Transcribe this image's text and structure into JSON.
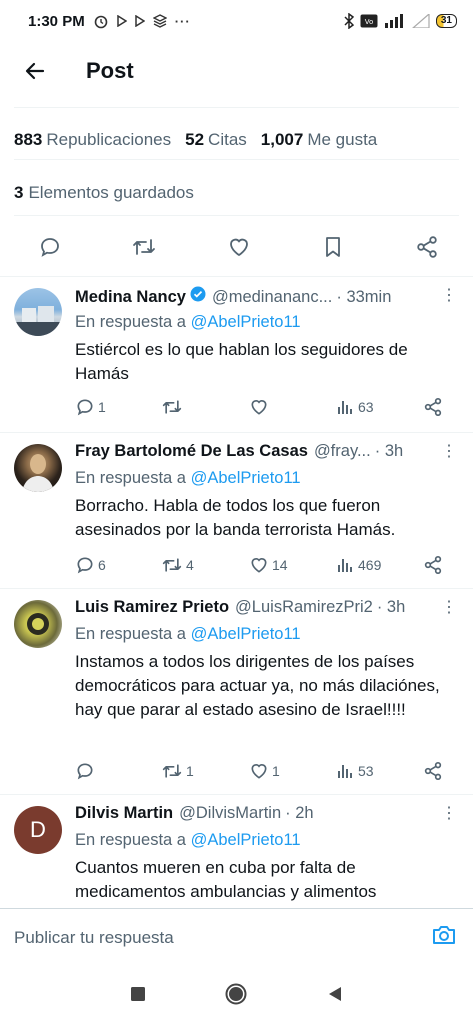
{
  "status_bar": {
    "time": "1:30 PM",
    "notif_icons": [
      "alarm-icon",
      "play-icon",
      "play-icon",
      "stack-icon",
      "more-dots-icon"
    ],
    "battery": "31"
  },
  "header": {
    "title": "Post"
  },
  "stats": {
    "reposts_count": "883",
    "reposts_label": "Republicaciones",
    "quotes_count": "52",
    "quotes_label": "Citas",
    "likes_count": "1,007",
    "likes_label": "Me gusta"
  },
  "saved": {
    "count": "3",
    "label": "Elementos guardados"
  },
  "replies": [
    {
      "name": "Medina Nancy",
      "verified": true,
      "handle": "@medinananc...",
      "time": "· 33min",
      "in_reply_prefix": "En respuesta a",
      "in_reply_mention": "@AbelPrieto11",
      "text": "Estiércol es lo que hablan los seguidores de Hamás",
      "replies": "1",
      "reposts": "",
      "likes": "",
      "views": "63"
    },
    {
      "name": "Fray Bartolomé De Las Casas",
      "handle": "@fray...",
      "time": "· 3h",
      "in_reply_prefix": "En respuesta a",
      "in_reply_mention": "@AbelPrieto11",
      "text": "Borracho. Habla de todos los que fueron asesinados por la banda terrorista Hamás.",
      "replies": "6",
      "reposts": "4",
      "likes": "14",
      "views": "469"
    },
    {
      "name": "Luis Ramirez Prieto",
      "handle": "@LuisRamirezPri2",
      "time": "· 3h",
      "in_reply_prefix": "En respuesta a",
      "in_reply_mention": "@AbelPrieto11",
      "text": "Instamos a todos los dirigentes de los países democráticos para actuar ya, no más dilaciónes, hay que parar al estado asesino de Israel!!!!",
      "replies": "",
      "reposts": "1",
      "likes": "1",
      "views": "53"
    },
    {
      "name": "Dilvis Martin",
      "handle": "@DilvisMartin",
      "time": "· 2h",
      "avatar_letter": "D",
      "in_reply_prefix": "En respuesta a",
      "in_reply_mention": "@AbelPrieto11",
      "text": "Cuantos mueren en cuba por falta de medicamentos ambulancias y alimentos"
    }
  ],
  "composer": {
    "placeholder": "Publicar tu respuesta"
  },
  "colors": {
    "accent": "#1d9bf0",
    "secondary_text": "#536471",
    "avatar_d": "#7a3b2e"
  }
}
